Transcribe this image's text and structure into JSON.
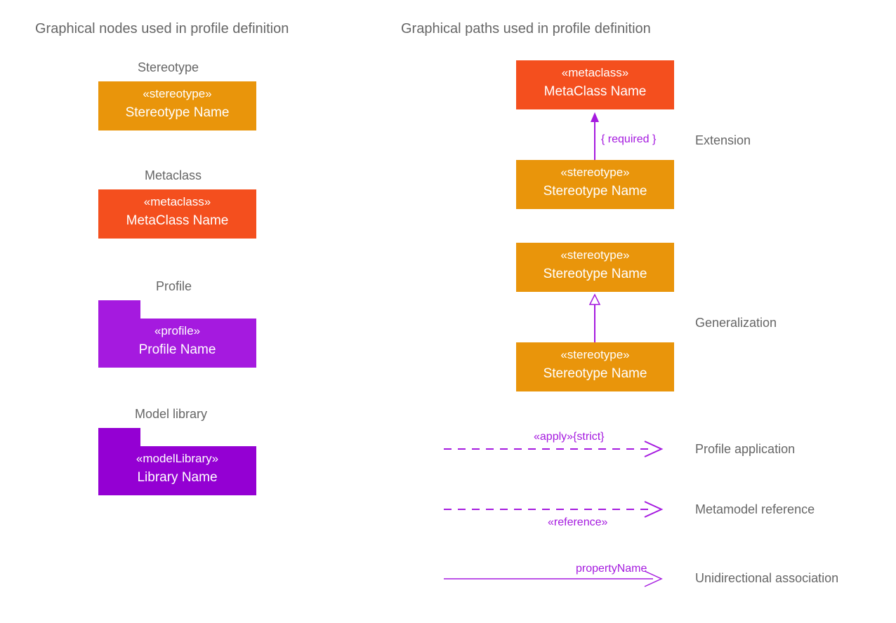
{
  "left": {
    "title": "Graphical nodes used in profile definition",
    "nodes": [
      {
        "label": "Stereotype",
        "guillemet": "«stereotype»",
        "name": "Stereotype Name"
      },
      {
        "label": "Metaclass",
        "guillemet": "«metaclass»",
        "name": "MetaClass Name"
      },
      {
        "label": "Profile",
        "guillemet": "«profile»",
        "name": "Profile Name"
      },
      {
        "label": "Model library",
        "guillemet": "«modelLibrary»",
        "name": "Library Name"
      }
    ]
  },
  "right": {
    "title": "Graphical paths used in profile definition",
    "extension": {
      "metaclass_guillemet": "«metaclass»",
      "metaclass_name": "MetaClass Name",
      "stereotype_guillemet": "«stereotype»",
      "stereotype_name": "Stereotype Name",
      "constraint": "{ required }",
      "label": "Extension"
    },
    "generalization": {
      "top_guillemet": "«stereotype»",
      "top_name": "Stereotype Name",
      "bottom_guillemet": "«stereotype»",
      "bottom_name": "Stereotype Name",
      "label": "Generalization"
    },
    "profile_application": {
      "text": "«apply»{strict}",
      "label": "Profile application"
    },
    "metamodel_reference": {
      "text": "«reference»",
      "label": "Metamodel reference"
    },
    "unidirectional": {
      "text": "propertyName",
      "label": "Unidirectional association"
    }
  }
}
